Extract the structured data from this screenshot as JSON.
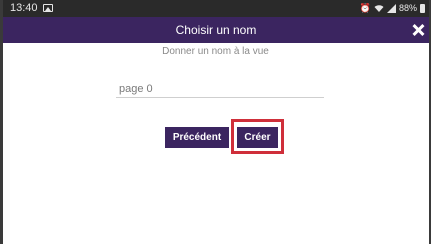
{
  "status_bar": {
    "time": "13:40",
    "battery_percent": "88%",
    "icons": [
      "gallery-icon",
      "alarm-icon",
      "wifi-icon",
      "signal-icon",
      "battery-icon"
    ]
  },
  "app_bar": {
    "title": "Choisir un nom",
    "close_icon": "close-icon"
  },
  "form": {
    "instruction": "Donner un nom à la vue",
    "name_value": "page 0"
  },
  "buttons": {
    "previous_label": "Précédent",
    "create_label": "Créer"
  },
  "colors": {
    "primary": "#3b2560",
    "highlight": "#cf2f3a",
    "status_bar": "#2a2a2a"
  }
}
